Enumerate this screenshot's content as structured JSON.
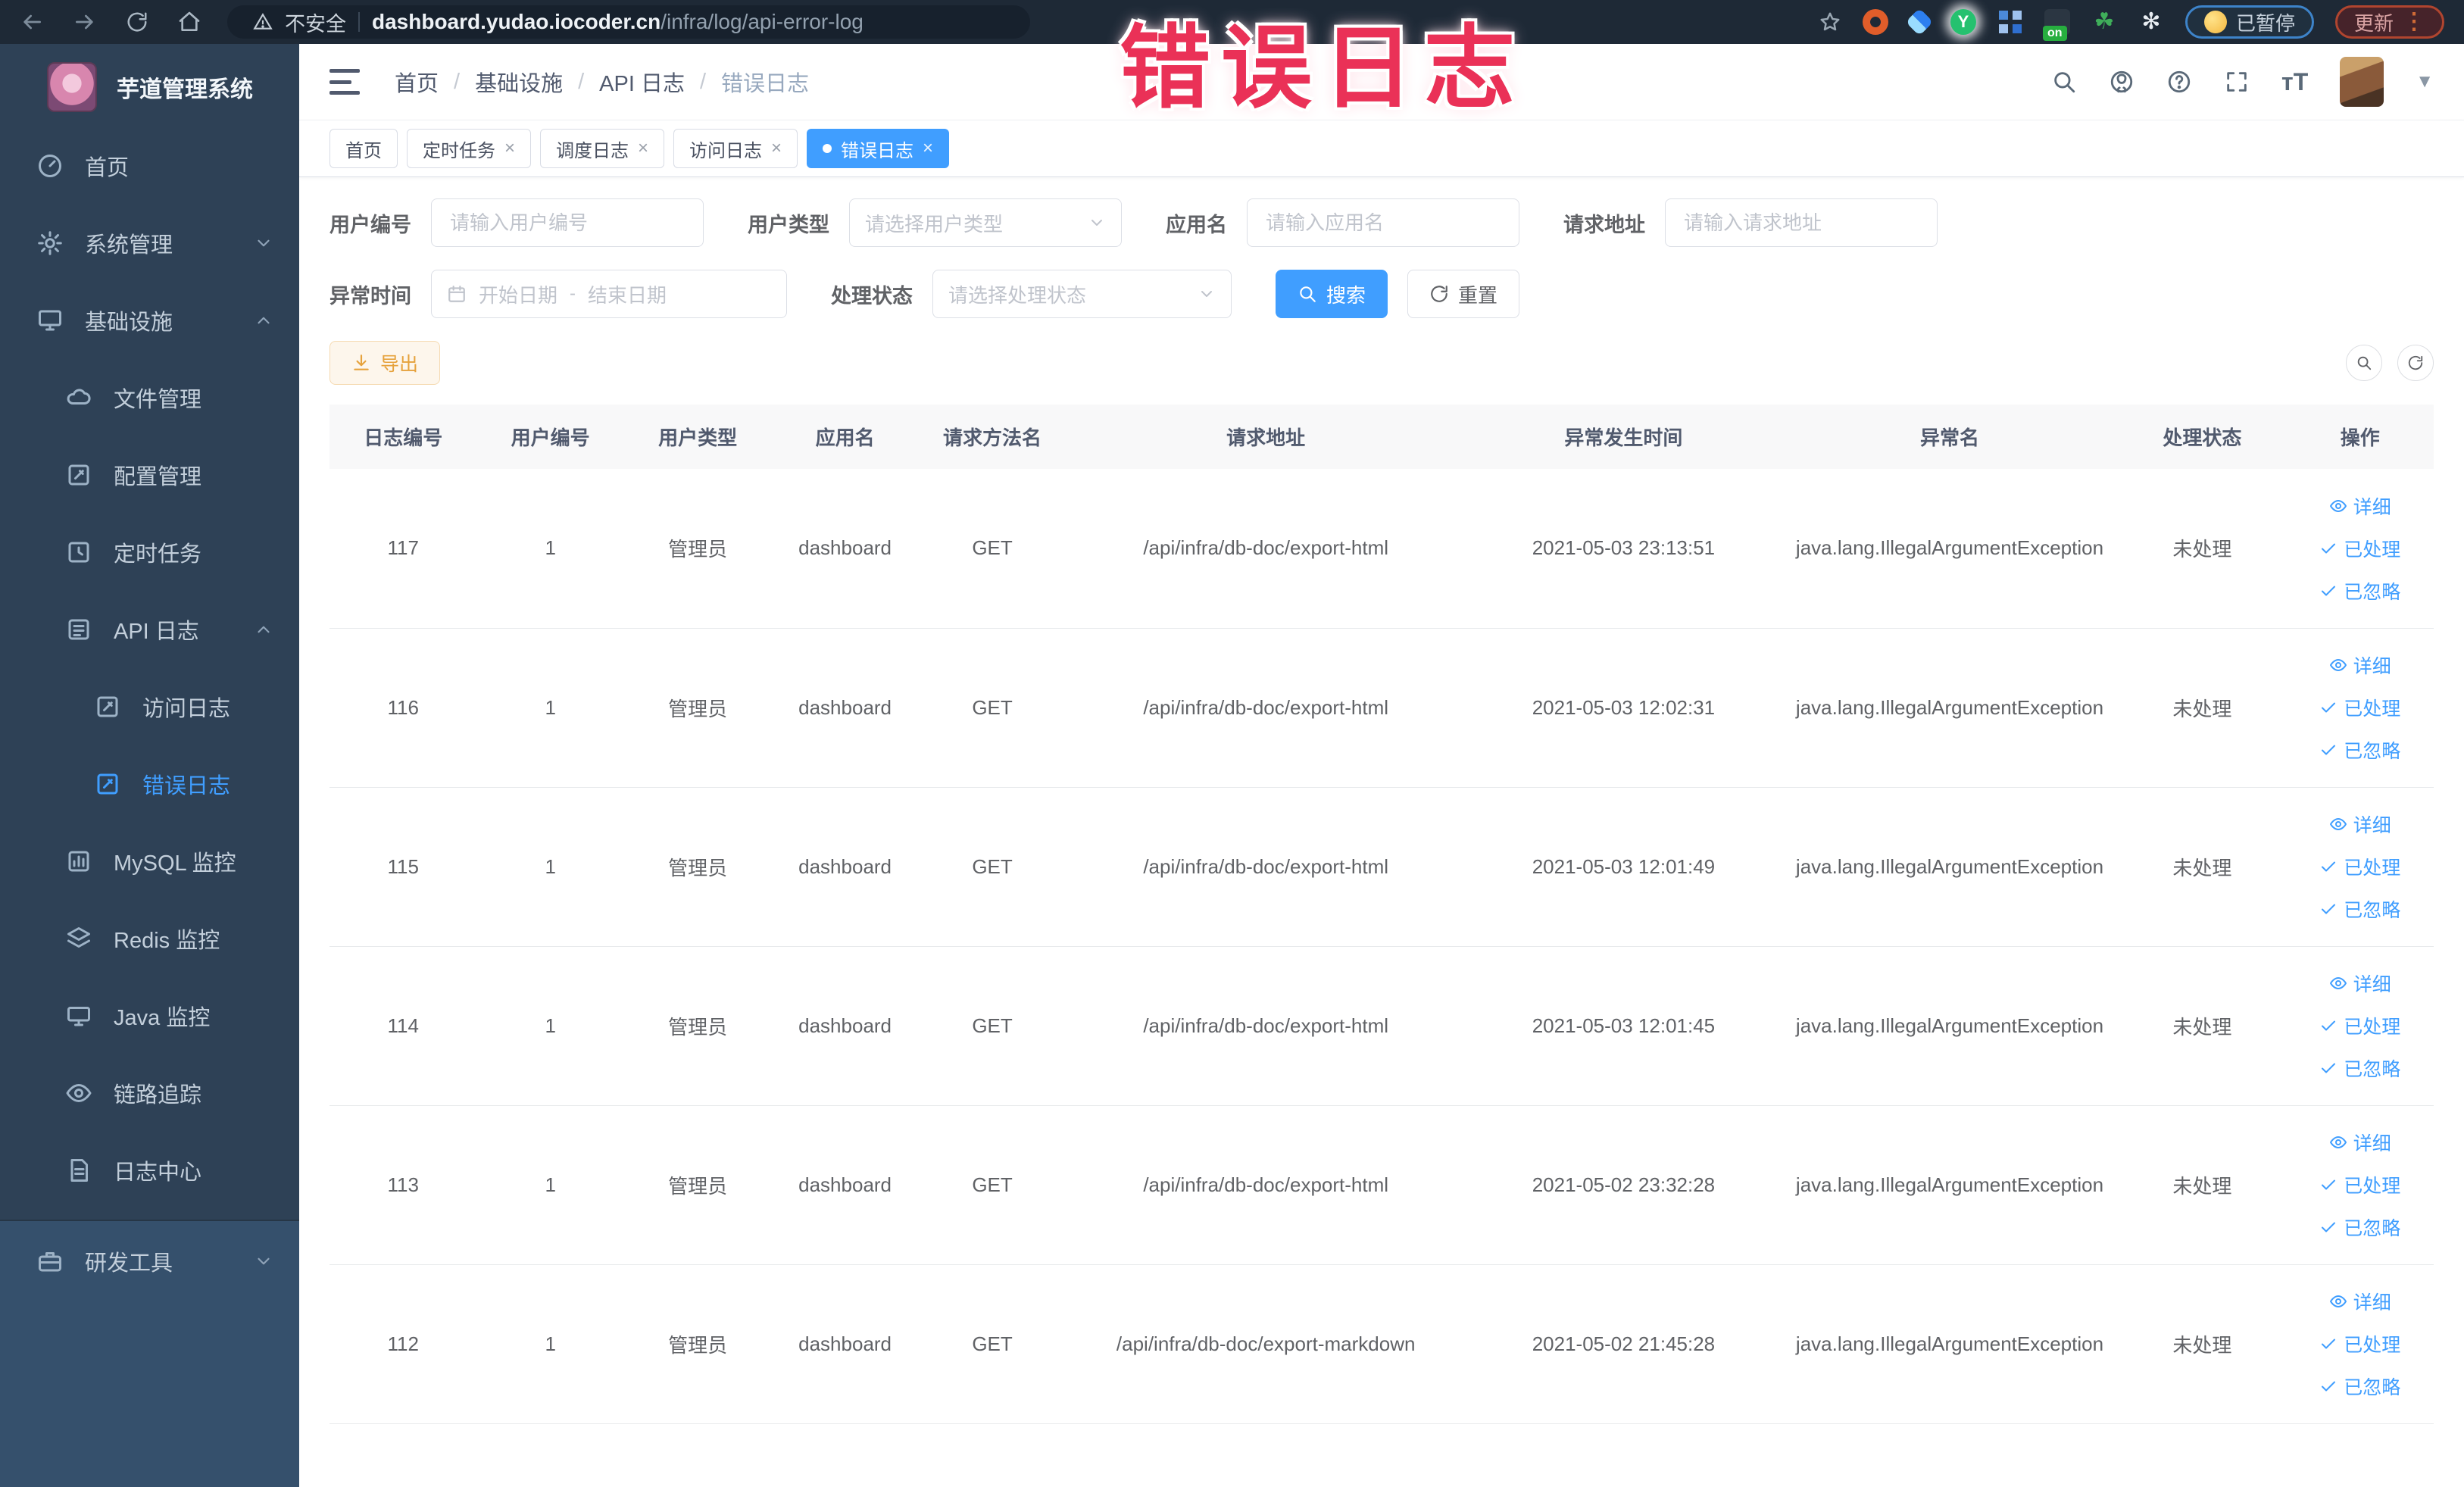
{
  "browser": {
    "security_label": "不安全",
    "url_domain": "dashboard.yudao.iocoder.cn",
    "url_path": "/infra/log/api-error-log",
    "paused_label": "已暂停",
    "update_label": "更新"
  },
  "watermark": "错误日志",
  "sidebar": {
    "title": "芋道管理系统",
    "items": [
      {
        "name": "home",
        "label": "首页",
        "icon": "dashboard",
        "level": 1
      },
      {
        "name": "system-management",
        "label": "系统管理",
        "icon": "gear",
        "level": 1,
        "chevron": "down"
      },
      {
        "name": "infrastructure",
        "label": "基础设施",
        "icon": "infra",
        "level": 1,
        "chevron": "up"
      },
      {
        "name": "file-management",
        "label": "文件管理",
        "icon": "cloud",
        "level": 2
      },
      {
        "name": "config-management",
        "label": "配置管理",
        "icon": "edit",
        "level": 2
      },
      {
        "name": "scheduled-tasks",
        "label": "定时任务",
        "icon": "timer",
        "level": 2
      },
      {
        "name": "api-logs",
        "label": "API 日志",
        "icon": "log",
        "level": 2,
        "chevron": "up"
      },
      {
        "name": "access-logs",
        "label": "访问日志",
        "icon": "edit",
        "level": 3
      },
      {
        "name": "error-logs",
        "label": "错误日志",
        "icon": "edit",
        "level": 3,
        "active": true
      },
      {
        "name": "mysql-monitor",
        "label": "MySQL 监控",
        "icon": "chart",
        "level": 2
      },
      {
        "name": "redis-monitor",
        "label": "Redis 监控",
        "icon": "layers",
        "level": 2
      },
      {
        "name": "java-monitor",
        "label": "Java 监控",
        "icon": "monitor",
        "level": 2
      },
      {
        "name": "trace",
        "label": "链路追踪",
        "icon": "eye",
        "level": 2
      },
      {
        "name": "log-center",
        "label": "日志中心",
        "icon": "doc",
        "level": 2
      },
      {
        "name": "dev-tools",
        "label": "研发工具",
        "icon": "tool",
        "level": 1,
        "chevron": "down",
        "section": "bottom"
      }
    ]
  },
  "header": {
    "breadcrumb": [
      "首页",
      "基础设施",
      "API 日志",
      "错误日志"
    ]
  },
  "tabs": [
    {
      "label": "首页",
      "closable": false,
      "active": false
    },
    {
      "label": "定时任务",
      "closable": true,
      "active": false
    },
    {
      "label": "调度日志",
      "closable": true,
      "active": false
    },
    {
      "label": "访问日志",
      "closable": true,
      "active": false
    },
    {
      "label": "错误日志",
      "closable": true,
      "active": true
    }
  ],
  "filters": {
    "user_id": {
      "label": "用户编号",
      "placeholder": "请输入用户编号"
    },
    "user_type": {
      "label": "用户类型",
      "placeholder": "请选择用户类型"
    },
    "app_name": {
      "label": "应用名",
      "placeholder": "请输入应用名"
    },
    "request_url": {
      "label": "请求地址",
      "placeholder": "请输入请求地址"
    },
    "exception_time": {
      "label": "异常时间",
      "start_placeholder": "开始日期",
      "separator": "-",
      "end_placeholder": "结束日期"
    },
    "process_status": {
      "label": "处理状态",
      "placeholder": "请选择处理状态"
    },
    "search_button": "搜索",
    "reset_button": "重置"
  },
  "toolbar": {
    "export_button": "导出"
  },
  "table": {
    "headers": [
      "日志编号",
      "用户编号",
      "用户类型",
      "应用名",
      "请求方法名",
      "请求地址",
      "异常发生时间",
      "异常名",
      "处理状态",
      "操作"
    ],
    "col_widths": [
      "7%",
      "7%",
      "7%",
      "7%",
      "7%",
      "19%",
      "15%",
      "16%",
      "8%",
      "7%"
    ],
    "rows": [
      [
        "117",
        "1",
        "管理员",
        "dashboard",
        "GET",
        "/api/infra/db-doc/export-html",
        "2021-05-03 23:13:51",
        "java.lang.IllegalArgumentException",
        "未处理"
      ],
      [
        "116",
        "1",
        "管理员",
        "dashboard",
        "GET",
        "/api/infra/db-doc/export-html",
        "2021-05-03 12:02:31",
        "java.lang.IllegalArgumentException",
        "未处理"
      ],
      [
        "115",
        "1",
        "管理员",
        "dashboard",
        "GET",
        "/api/infra/db-doc/export-html",
        "2021-05-03 12:01:49",
        "java.lang.IllegalArgumentException",
        "未处理"
      ],
      [
        "114",
        "1",
        "管理员",
        "dashboard",
        "GET",
        "/api/infra/db-doc/export-html",
        "2021-05-03 12:01:45",
        "java.lang.IllegalArgumentException",
        "未处理"
      ],
      [
        "113",
        "1",
        "管理员",
        "dashboard",
        "GET",
        "/api/infra/db-doc/export-html",
        "2021-05-02 23:32:28",
        "java.lang.IllegalArgumentException",
        "未处理"
      ],
      [
        "112",
        "1",
        "管理员",
        "dashboard",
        "GET",
        "/api/infra/db-doc/export-markdown",
        "2021-05-02 21:45:28",
        "java.lang.IllegalArgumentException",
        "未处理"
      ]
    ],
    "row_actions": [
      {
        "label": "详细",
        "icon": "eye",
        "name": "detail-link"
      },
      {
        "label": "已处理",
        "icon": "check",
        "name": "mark-processed-link"
      },
      {
        "label": "已忽略",
        "icon": "check",
        "name": "mark-ignored-link"
      }
    ]
  },
  "colors": {
    "accent": "#409eff",
    "watermark": "#ea3157",
    "warning": "#e6a23c",
    "sidebar_bg": "#2e4156"
  }
}
